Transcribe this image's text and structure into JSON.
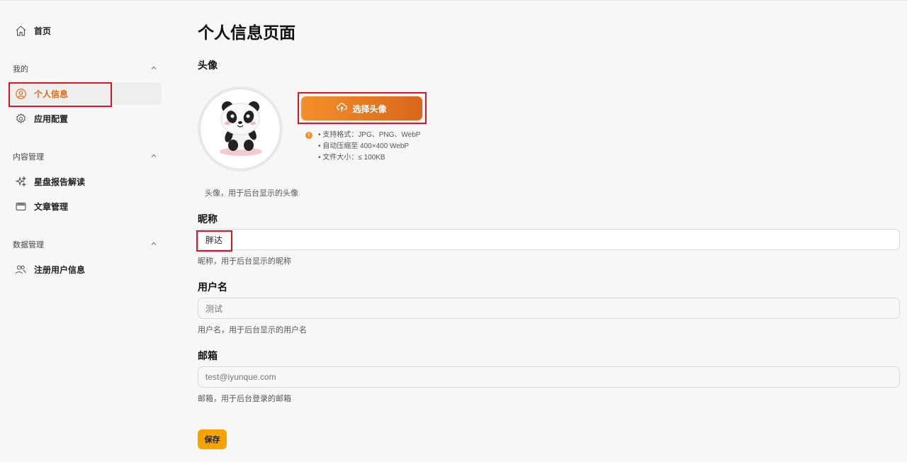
{
  "sidebar": {
    "home": {
      "label": "首页",
      "icon": "home-icon"
    },
    "groups": [
      {
        "title": "我的",
        "items": [
          {
            "label": "个人信息",
            "icon": "user-circle-icon",
            "active": true
          },
          {
            "label": "应用配置",
            "icon": "settings-gear-icon"
          }
        ]
      },
      {
        "title": "内容管理",
        "items": [
          {
            "label": "星盘报告解读",
            "icon": "sparkles-icon"
          },
          {
            "label": "文章管理",
            "icon": "archive-box-icon"
          }
        ]
      },
      {
        "title": "数据管理",
        "items": [
          {
            "label": "注册用户信息",
            "icon": "users-icon"
          }
        ]
      }
    ]
  },
  "main": {
    "title": "个人信息页面",
    "avatar": {
      "label": "头像",
      "button_label": "选择头像",
      "hints": [
        "• 支持格式：JPG、PNG、WebP",
        "• 自动压缩至 400×400 WebP",
        "• 文件大小：≤ 100KB"
      ],
      "helper": "头像，用于后台显示的头像"
    },
    "nickname": {
      "label": "昵称",
      "value": "胖达",
      "helper": "昵称，用于后台显示的昵称"
    },
    "username": {
      "label": "用户名",
      "value": "测试",
      "helper": "用户名，用于后台显示的用户名"
    },
    "email": {
      "label": "邮箱",
      "value": "test@iyunque.com",
      "helper": "邮箱，用于后台登录的邮箱"
    },
    "save_label": "保存"
  },
  "colors": {
    "accent": "#e46a11",
    "button_gradient_start": "#f3902a",
    "button_gradient_end": "#d9671b",
    "save": "#f5a300",
    "highlight_box": "#e0141c"
  }
}
